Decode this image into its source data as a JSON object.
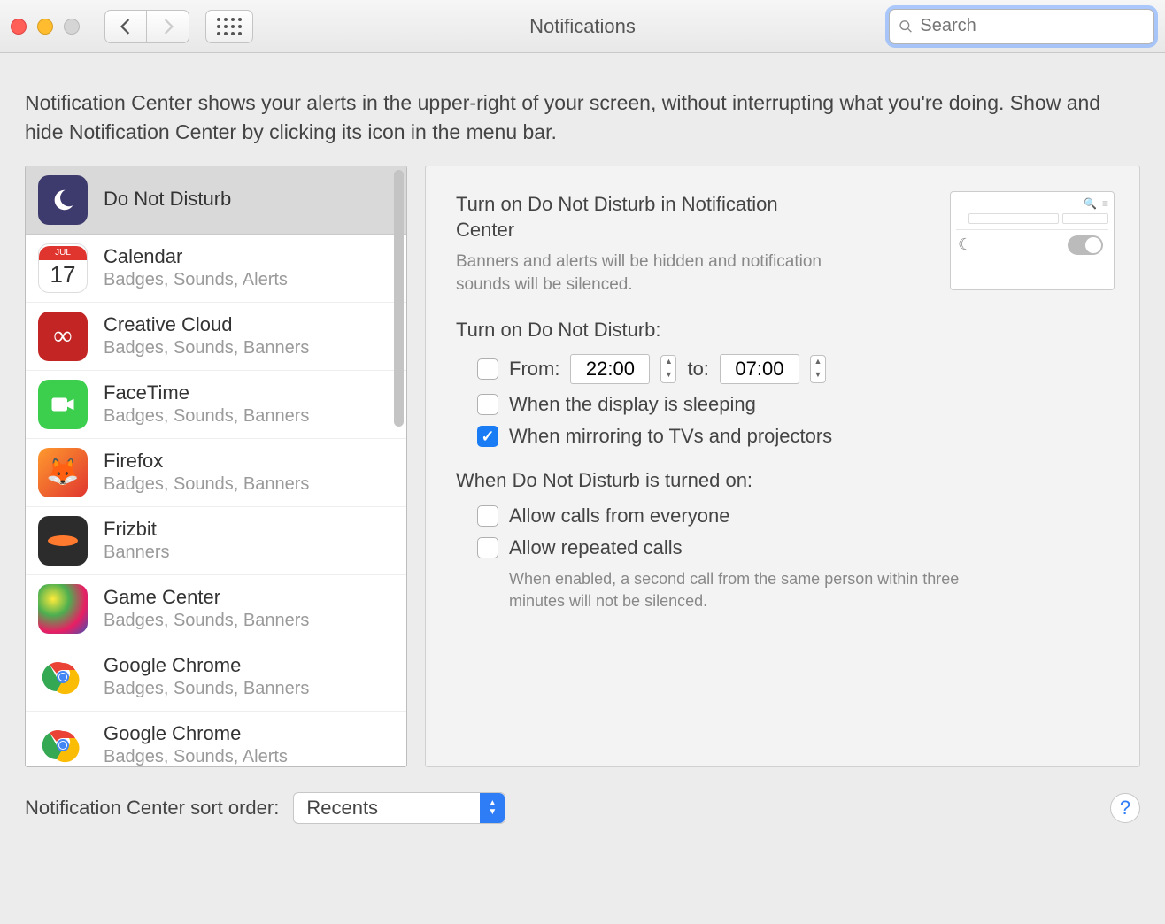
{
  "window": {
    "title": "Notifications",
    "search_placeholder": "Search"
  },
  "intro": "Notification Center shows your alerts in the upper-right of your screen, without interrupting what you're doing. Show and hide Notification Center by clicking its icon in the menu bar.",
  "sidebar": {
    "items": [
      {
        "name": "Do Not Disturb",
        "sub": "",
        "icon": "dnd",
        "selected": true
      },
      {
        "name": "Calendar",
        "sub": "Badges, Sounds, Alerts",
        "icon": "calendar",
        "cal_month": "JUL",
        "cal_day": "17"
      },
      {
        "name": "Creative Cloud",
        "sub": "Badges, Sounds, Banners",
        "icon": "creative-cloud"
      },
      {
        "name": "FaceTime",
        "sub": "Badges, Sounds, Banners",
        "icon": "facetime"
      },
      {
        "name": "Firefox",
        "sub": "Badges, Sounds, Banners",
        "icon": "firefox"
      },
      {
        "name": "Frizbit",
        "sub": "Banners",
        "icon": "frizbit"
      },
      {
        "name": "Game Center",
        "sub": "Badges, Sounds, Banners",
        "icon": "game-center"
      },
      {
        "name": "Google Chrome",
        "sub": "Badges, Sounds, Banners",
        "icon": "chrome"
      },
      {
        "name": "Google Chrome",
        "sub": "Badges, Sounds, Alerts",
        "icon": "chrome"
      }
    ]
  },
  "detail": {
    "heading": "Turn on Do Not Disturb in Notification Center",
    "sub": "Banners and alerts will be hidden and notification sounds will be silenced.",
    "schedule_heading": "Turn on Do Not Disturb:",
    "from_label": "From:",
    "from_value": "22:00",
    "to_label": "to:",
    "to_value": "07:00",
    "schedule_checked": false,
    "sleeping_label": "When the display is sleeping",
    "sleeping_checked": false,
    "mirroring_label": "When mirroring to TVs and projectors",
    "mirroring_checked": true,
    "on_heading": "When Do Not Disturb is turned on:",
    "allow_everyone_label": "Allow calls from everyone",
    "allow_everyone_checked": false,
    "allow_repeated_label": "Allow repeated calls",
    "allow_repeated_checked": false,
    "repeated_note": "When enabled, a second call from the same person within three minutes will not be silenced."
  },
  "footer": {
    "sort_label": "Notification Center sort order:",
    "sort_value": "Recents"
  }
}
